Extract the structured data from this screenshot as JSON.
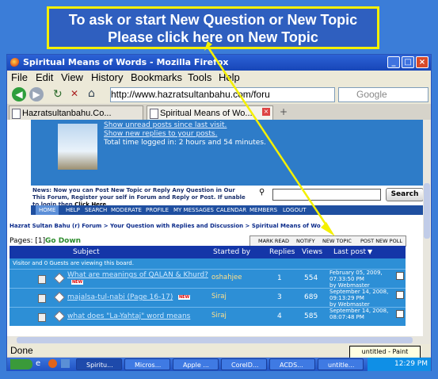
{
  "callout": {
    "line1": "To ask or start New Question or New Topic",
    "line2": "Please click here on New Topic"
  },
  "window": {
    "title": "Spiritual Means of Words - Mozilla Firefox",
    "controls": [
      "_",
      "□",
      "×"
    ]
  },
  "menu": [
    "File",
    "Edit",
    "View",
    "History",
    "Bookmarks",
    "Tools",
    "Help"
  ],
  "nav": {
    "url": "http://www.hazratsultanbahu.com/foru",
    "search_placeholder": "Google"
  },
  "tabs": [
    {
      "label": "Hazratsultanbahu.Co...",
      "active": false
    },
    {
      "label": "Spiritual Means of Wo...",
      "active": true
    }
  ],
  "forum": {
    "header_lines": [
      "Show unread posts since last visit.",
      "Show new replies to your posts.",
      "Total time logged in: 2 hours and 54 minutes."
    ],
    "news": "News: Now you can Post New Topic or Reply Any Question in Our This Forum, Register your self in Forum and Reply or Post. If unable to login then",
    "news_link": "Click Here",
    "search_button": "Search",
    "nav_items": [
      "HOME",
      "HELP",
      "SEARCH",
      "MODERATE",
      "PROFILE",
      "MY MESSAGES",
      "CALENDAR",
      "MEMBERS",
      "LOGOUT"
    ],
    "breadcrumb": "Hazrat Sultan Bahu (r) Forum > Your Question with Replies and Discussion > Spiritual Means of Wo",
    "pages_label": "Pages: [1]",
    "go_down": "Go Down",
    "actions": [
      "MARK READ",
      "NOTIFY",
      "NEW TOPIC",
      "POST NEW POLL"
    ],
    "columns": [
      "Subject",
      "Started by",
      "Replies",
      "Views",
      "Last post"
    ],
    "viewers": "Visitor and 0 Guests are viewing this board.",
    "topics": [
      {
        "subject": "What are meanings of QALAN & Khurd?",
        "starter": "oshahjee",
        "replies": "1",
        "views": "554",
        "last_date": "February 05, 2009,",
        "last_time": "07:33:50 PM",
        "last_by": "by Webmaster",
        "badge": "NEW"
      },
      {
        "subject": "majalsa-tul-nabi (Page 16-17)",
        "starter": "Siraj",
        "replies": "3",
        "views": "689",
        "last_date": "September 14, 2008,",
        "last_time": "09:13:29 PM",
        "last_by": "by Webmaster",
        "badge": "NEW"
      },
      {
        "subject": "what does \"La-Yahtaj\" word means",
        "starter": "Siraj",
        "replies": "4",
        "views": "585",
        "last_date": "September 14, 2008,",
        "last_time": "08:07:48 PM",
        "last_by": "",
        "badge": ""
      }
    ]
  },
  "status": {
    "text": "Done",
    "tooltip": "untitled - Paint"
  },
  "taskbar": {
    "items": [
      "Spiritu...",
      "Micros...",
      "Apple ...",
      "CorelD...",
      "ACDS...",
      "untitle..."
    ],
    "clock": "12:29 PM"
  },
  "colors": {
    "callout_border": "#f4f000",
    "callout_bg": "#2f5fbf",
    "forum_blue": "#2d8fd6",
    "table_header": "#1436a8"
  }
}
